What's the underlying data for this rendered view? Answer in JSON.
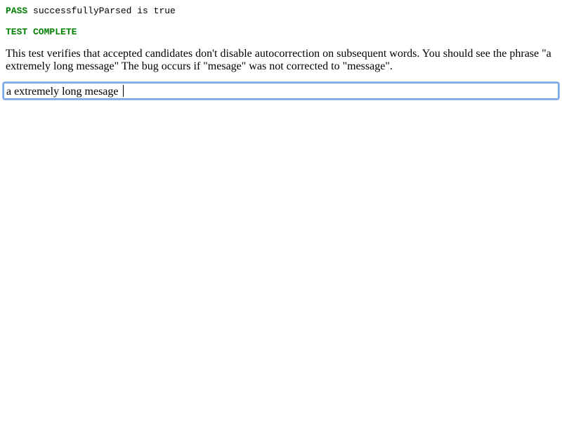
{
  "console": {
    "pass_label": "PASS",
    "pass_message": " successfullyParsed is true",
    "complete_label": "TEST COMPLETE"
  },
  "description": "This test verifies that accepted candidates don't disable autocorrection on subsequent words. You should see the phrase \"a extremely long message\" The bug occurs if \"mesage\" was not corrected to \"message\".",
  "editor": {
    "value": "a extremely long mesage "
  },
  "colors": {
    "pass": "#008000",
    "focus_ring": "#7aa7e8"
  }
}
